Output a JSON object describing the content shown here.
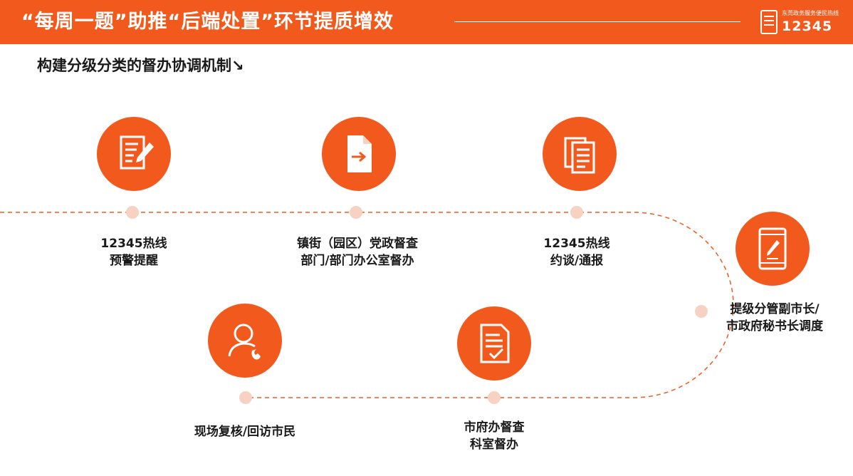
{
  "header": {
    "title": "“每周一题”助推“后端处置”环节提质增效",
    "logo_text": "东莞政务服务便民热线",
    "logo_number": "12345"
  },
  "subtitle": "构建分级分类的督办协调机制↘",
  "colors": {
    "accent": "#f25a1d",
    "dot": "#f7d2c2",
    "text": "#1a1a1a"
  },
  "steps": [
    {
      "icon": "document-edit-icon",
      "lines": [
        "12345热线",
        "预警提醒"
      ]
    },
    {
      "icon": "file-forward-icon",
      "lines": [
        "镇街（园区）党政督查",
        "部门/部门办公室督办"
      ]
    },
    {
      "icon": "documents-icon",
      "lines": [
        "12345热线",
        "约谈/通报"
      ]
    },
    {
      "icon": "tablet-pen-icon",
      "lines": [
        "提级分管副市长/",
        "市政府秘书长调度"
      ]
    },
    {
      "icon": "checklist-icon",
      "lines": [
        "市府办督查",
        "科室督办"
      ]
    },
    {
      "icon": "user-phone-icon",
      "lines": [
        "现场复核/回访市民"
      ]
    }
  ]
}
